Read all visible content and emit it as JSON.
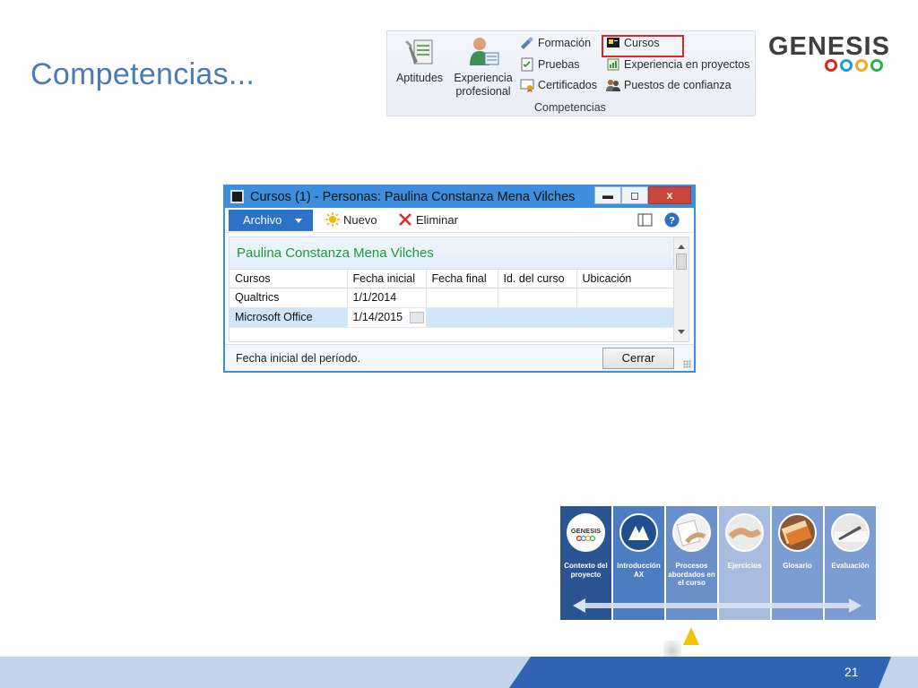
{
  "slide": {
    "title": "Competencias...",
    "page_number": "21"
  },
  "ribbon": {
    "big_buttons": [
      {
        "label": "Aptitudes",
        "icon": "aptitudes-icon"
      },
      {
        "label_line1": "Experiencia",
        "label_line2": "profesional",
        "icon": "experiencia-profesional-icon"
      }
    ],
    "small_buttons": [
      {
        "label": "Formación",
        "icon": "formacion-icon"
      },
      {
        "label": "Pruebas",
        "icon": "pruebas-icon"
      },
      {
        "label": "Certificados",
        "icon": "certificados-icon"
      },
      {
        "label": "Cursos",
        "icon": "cursos-icon",
        "highlighted": true
      },
      {
        "label": "Experiencia en proyectos",
        "icon": "experiencia-proyectos-icon"
      },
      {
        "label": "Puestos de confianza",
        "icon": "puestos-confianza-icon"
      }
    ],
    "group_label": "Competencias"
  },
  "logo": {
    "text": "GENESIS",
    "ring_colors": [
      "#e2231a",
      "#1f9ad6",
      "#f5a623",
      "#2bb24c"
    ]
  },
  "dialog": {
    "title": "Cursos (1) - Personas: Paulina Constanza Mena  Vilches",
    "controls": {
      "minimize": "▬",
      "maximize": "◻",
      "close": "x"
    },
    "toolbar": {
      "archivo": "Archivo",
      "nuevo": "Nuevo",
      "eliminar": "Eliminar"
    },
    "person_name": "Paulina Constanza Mena  Vilches",
    "columns": [
      "Cursos",
      "Fecha inicial",
      "Fecha final",
      "Id. del curso",
      "Ubicación"
    ],
    "rows": [
      {
        "curso": "Qualtrics",
        "fecha_inicial": "1/1/2014",
        "fecha_final": "",
        "id_curso": "",
        "ubicacion": ""
      },
      {
        "curso": "Microsoft Office",
        "fecha_inicial": "1/14/2015",
        "fecha_final": "",
        "id_curso": "",
        "ubicacion": "",
        "selected": true
      }
    ],
    "status_text": "Fecha inicial del período.",
    "cerrar": "Cerrar"
  },
  "nav_tiles": [
    {
      "label": "Contexto del proyecto",
      "icon": "genesis-logo-icon",
      "color": "#2a5592"
    },
    {
      "label": "Introducción AX",
      "icon": "dynamics-ax-icon",
      "color": "#4c7dc1"
    },
    {
      "label": "Procesos abordados en el curso",
      "icon": "handshake-paper-icon",
      "color": "#6b90c9",
      "current": true
    },
    {
      "label": "Ejercicios",
      "icon": "handshake-icon",
      "color": "#a8bce0"
    },
    {
      "label": "Glosario",
      "icon": "book-icon",
      "color": "#7c9dd2"
    },
    {
      "label": "Evaluación",
      "icon": "pen-icon",
      "color": "#7c9dd2"
    }
  ]
}
